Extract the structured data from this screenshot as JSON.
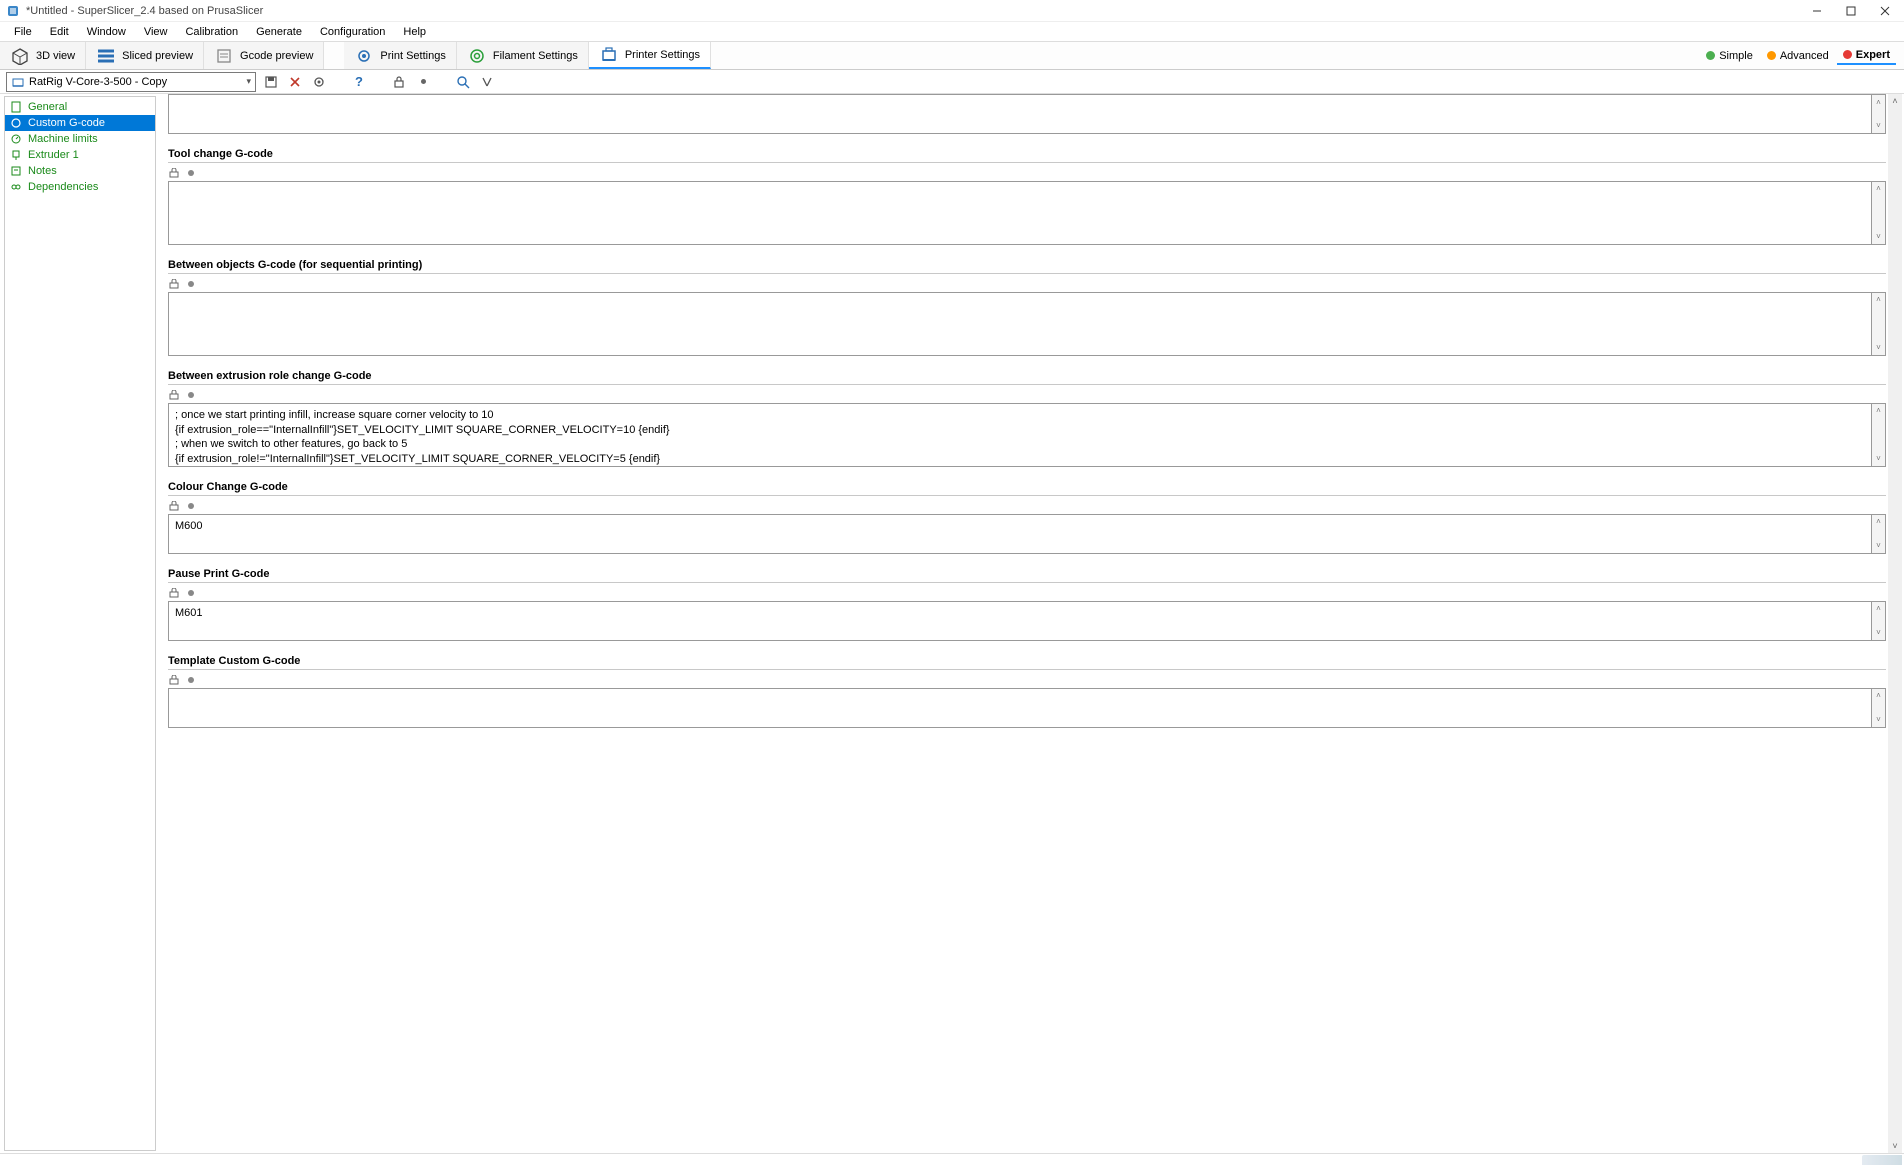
{
  "window": {
    "title": "*Untitled - SuperSlicer_2.4  based on PrusaSlicer"
  },
  "menu": {
    "file": "File",
    "edit": "Edit",
    "window": "Window",
    "view": "View",
    "calibration": "Calibration",
    "generate": "Generate",
    "configuration": "Configuration",
    "help": "Help"
  },
  "toolbar": {
    "view3d": "3D view",
    "sliced_preview": "Sliced preview",
    "gcode_preview": "Gcode preview",
    "print_settings": "Print Settings",
    "filament_settings": "Filament Settings",
    "printer_settings": "Printer Settings"
  },
  "modes": {
    "simple": "Simple",
    "advanced": "Advanced",
    "expert": "Expert"
  },
  "profile": {
    "selected": "RatRig V-Core-3-500 - Copy"
  },
  "sidebar": {
    "general": "General",
    "custom_gcode": "Custom G-code",
    "machine_limits": "Machine limits",
    "extruder1": "Extruder 1",
    "notes": "Notes",
    "dependencies": "Dependencies"
  },
  "sections": {
    "tool_change": {
      "title": "Tool change G-code",
      "value": ""
    },
    "between_objects": {
      "title": "Between objects G-code (for sequential printing)",
      "value": ""
    },
    "between_extrusion": {
      "title": "Between extrusion role change G-code",
      "value": "; once we start printing infill, increase square corner velocity to 10\n{if extrusion_role==\"InternalInfill\"}SET_VELOCITY_LIMIT SQUARE_CORNER_VELOCITY=10 {endif}\n; when we switch to other features, go back to 5\n{if extrusion_role!=\"InternalInfill\"}SET_VELOCITY_LIMIT SQUARE_CORNER_VELOCITY=5 {endif}"
    },
    "colour_change": {
      "title": "Colour Change G-code",
      "value": "M600"
    },
    "pause_print": {
      "title": "Pause Print G-code",
      "value": "M601"
    },
    "template_custom": {
      "title": "Template Custom G-code",
      "value": ""
    }
  }
}
